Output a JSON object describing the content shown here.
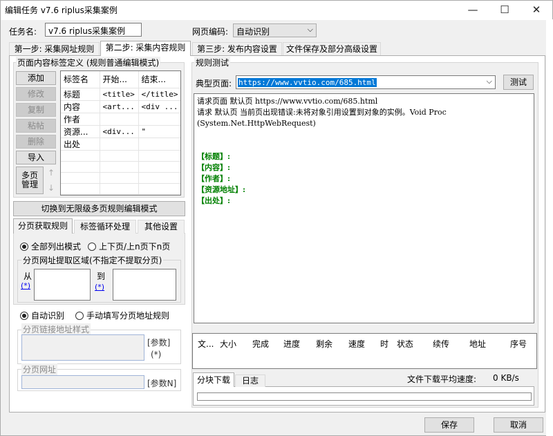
{
  "window": {
    "title": "编辑任务 v7.6 riplus采集案例",
    "minimize": "—",
    "maximize": "☐",
    "close": "✕"
  },
  "task": {
    "name_label": "任务名:",
    "name_value": "v7.6 riplus采集案例",
    "encoding_label": "网页编码:",
    "encoding_value": "自动识别"
  },
  "tabs": [
    "第一步: 采集网址规则",
    "第二步: 采集内容规则",
    "第三步: 发布内容设置",
    "文件保存及部分高级设置"
  ],
  "left": {
    "group_title": "页面内容标签定义 (规则普通编辑模式)",
    "buttons": [
      "添加",
      "修改",
      "复制",
      "粘帖",
      "删除",
      "导入"
    ],
    "multipage": "多页\n管理",
    "up": "↑",
    "down": "↓",
    "table_headers": [
      "标签名",
      "开始...",
      "结束..."
    ],
    "rows": [
      [
        "标题",
        "<title>",
        "</title>"
      ],
      [
        "内容",
        "<art...",
        "<div ..."
      ],
      [
        "作者",
        "",
        ""
      ],
      [
        "资源...",
        "<div...",
        "\""
      ],
      [
        "出处",
        "",
        ""
      ]
    ],
    "switch_button": "切换到无限级多页规则编辑模式",
    "subtabs": [
      "分页获取规则",
      "标签循环处理",
      "其他设置"
    ],
    "radio_all": "全部列出模式",
    "radio_prev": "上下页/上n页下n页",
    "area_title": "分页网址提取区域(不指定不提取分页)",
    "from": "从",
    "to": "到",
    "star": "(*)",
    "radio_auto": "自动识别",
    "radio_manual": "手动填写分页地址规则",
    "link_style_title": "分页链接地址样式",
    "param": "[参数]",
    "param_star": "(*)",
    "page_url_title": "分页网址",
    "param_n": "[参数N]"
  },
  "right": {
    "group_title": "规则测试",
    "typical_label": "典型页面:",
    "typical_url": "https://www.vvtio.com/685.html",
    "test_button": "测试",
    "output_lines": [
      "请求页面 默认页 https://www.vvtio.com/685.html",
      "请求 默认页 当前页出现错误:未将对象引用设置到对象的实例。Void Proc",
      "(System.Net.HttpWebRequest)"
    ],
    "fields": [
      "【标题】:",
      "【内容】:",
      "【作者】:",
      "【资源地址】:",
      "【出处】:"
    ],
    "download_headers": [
      "文...",
      "大小",
      "完成",
      "进度",
      "剩余",
      "速度",
      "时",
      "状态",
      "续传",
      "地址",
      "序号"
    ],
    "bottom_tabs": [
      "分块下载",
      "日志"
    ],
    "avg_speed_label": "文件下载平均速度:",
    "avg_speed_value": "0 KB/s"
  },
  "footer": {
    "save": "保存",
    "cancel": "取消"
  }
}
